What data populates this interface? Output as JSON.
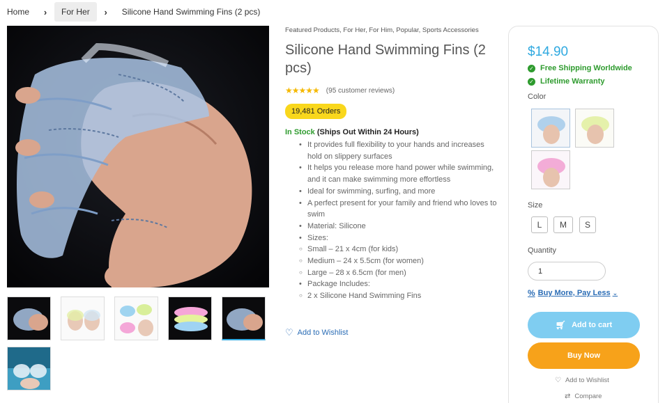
{
  "breadcrumb": {
    "home": "Home",
    "category": "For Her",
    "current": "Silicone Hand Swimming Fins (2 pcs)",
    "separator": "›"
  },
  "product": {
    "categories": "Featured Products, For Her, For Him, Popular, Sports Accessories",
    "title": "Silicone Hand Swimming Fins (2 pcs)",
    "stars": "★★★★★",
    "rating_value": 5,
    "reviews": "(95 customer reviews)",
    "orders": "19,481 Orders",
    "stock_status": "In Stock",
    "stock_note": "(Ships Out Within 24 Hours)",
    "features": [
      "It provides full flexibility to your hands and increases hold on slippery surfaces",
      "It helps you release more hand power while swimming, and it can make swimming more effortless",
      "Ideal for swimming, surfing, and more",
      "A perfect present for your family and friend who loves to swim",
      "Material: Silicone",
      "Sizes:"
    ],
    "sizes_detail": [
      "Small – 21 x 4cm (for kids)",
      "Medium – 24 x 5.5cm (for women)",
      "Large – 28 x 6.5cm (for men)"
    ],
    "package_label": "Package Includes:",
    "package_items": [
      "2 x Silicone Hand Swimming Fins"
    ],
    "wishlist": "Add to Wishlist"
  },
  "panel": {
    "price": "$14.90",
    "perk_shipping": "Free Shipping Worldwide",
    "perk_warranty": "Lifetime Warranty",
    "color_label": "Color",
    "size_label": "Size",
    "sizes": [
      "L",
      "M",
      "S"
    ],
    "quantity_label": "Quantity",
    "quantity_value": "1",
    "buy_more": "Buy More, Pay Less",
    "add_to_cart": "Add to cart",
    "buy_now": "Buy Now",
    "wishlist": "Add to Wishlist",
    "compare": "Compare"
  },
  "icons": {
    "chevron": "chevron-right-icon",
    "heart": "heart-icon",
    "check": "check-circle-icon",
    "cart": "cart-icon",
    "percent": "percent-icon",
    "compare": "compare-icon"
  },
  "colors": {
    "price": "#2fa9e0",
    "green": "#2e9b2e",
    "orders_badge": "#f9d71c",
    "cart_button": "#7fcdf1",
    "buy_button": "#f7a21a",
    "link": "#2a6cb5"
  }
}
